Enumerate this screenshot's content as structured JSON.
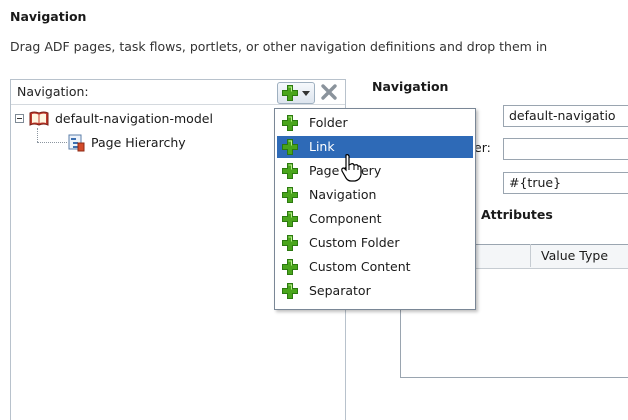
{
  "section": {
    "title": "Navigation",
    "description": "Drag ADF pages, task flows, portlets, or other navigation definitions and drop them in"
  },
  "left_panel": {
    "header_label": "Navigation:",
    "tree": [
      {
        "label": "default-navigation-model",
        "icon": "book-icon"
      },
      {
        "label": "Page Hierarchy",
        "icon": "page-hierarchy-icon"
      }
    ]
  },
  "right_panel": {
    "title": "Navigation",
    "fields": {
      "id_value": "default-navigatio",
      "partial_label": "er:",
      "second_value": "",
      "visible_value": "#{true}"
    },
    "attributes_title": "Attributes",
    "attributes_title_prefix": "Attr",
    "table_column": "Value Type"
  },
  "menu": {
    "items": [
      "Folder",
      "Link",
      "Page Query",
      "Navigation",
      "Component",
      "Custom Folder",
      "Custom Content",
      "Separator"
    ],
    "selected_index": 1
  },
  "colors": {
    "selection": "#2e6ab7",
    "plus_green": "#4aa51c",
    "delete_gray": "#8a939c"
  }
}
